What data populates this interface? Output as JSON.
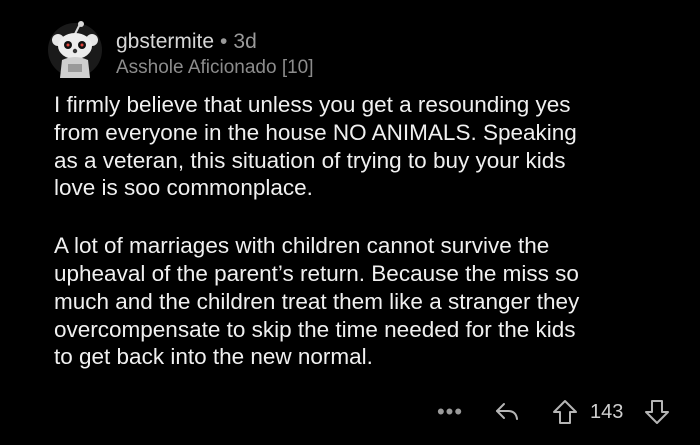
{
  "comment": {
    "username": "gbstermite",
    "separator": "•",
    "age": "3d",
    "flair": "Asshole Aficionado [10]",
    "paragraphs": [
      "I firmly believe that unless you get a resounding yes\nfrom everyone in the house NO ANIMALS. Speaking\nas a veteran, this situation of trying to buy your kids\nlove is soo commonplace.",
      "A lot of marriages with children cannot survive the\nupheaval of the parent’s return.  Because the miss so\nmuch and the children treat them like a stranger they\novercompensate to skip the time needed for the kids\nto get back into the new normal."
    ],
    "actions": {
      "more_label": "•••",
      "score": "143"
    }
  },
  "icons": {
    "avatar": "snoo-avatar-icon",
    "more": "more-options-icon",
    "reply": "reply-icon",
    "upvote": "upvote-arrow-icon",
    "downvote": "downvote-arrow-icon"
  },
  "colors": {
    "background": "#000000",
    "text": "#f0f0f0",
    "muted": "#9a9a9a"
  }
}
